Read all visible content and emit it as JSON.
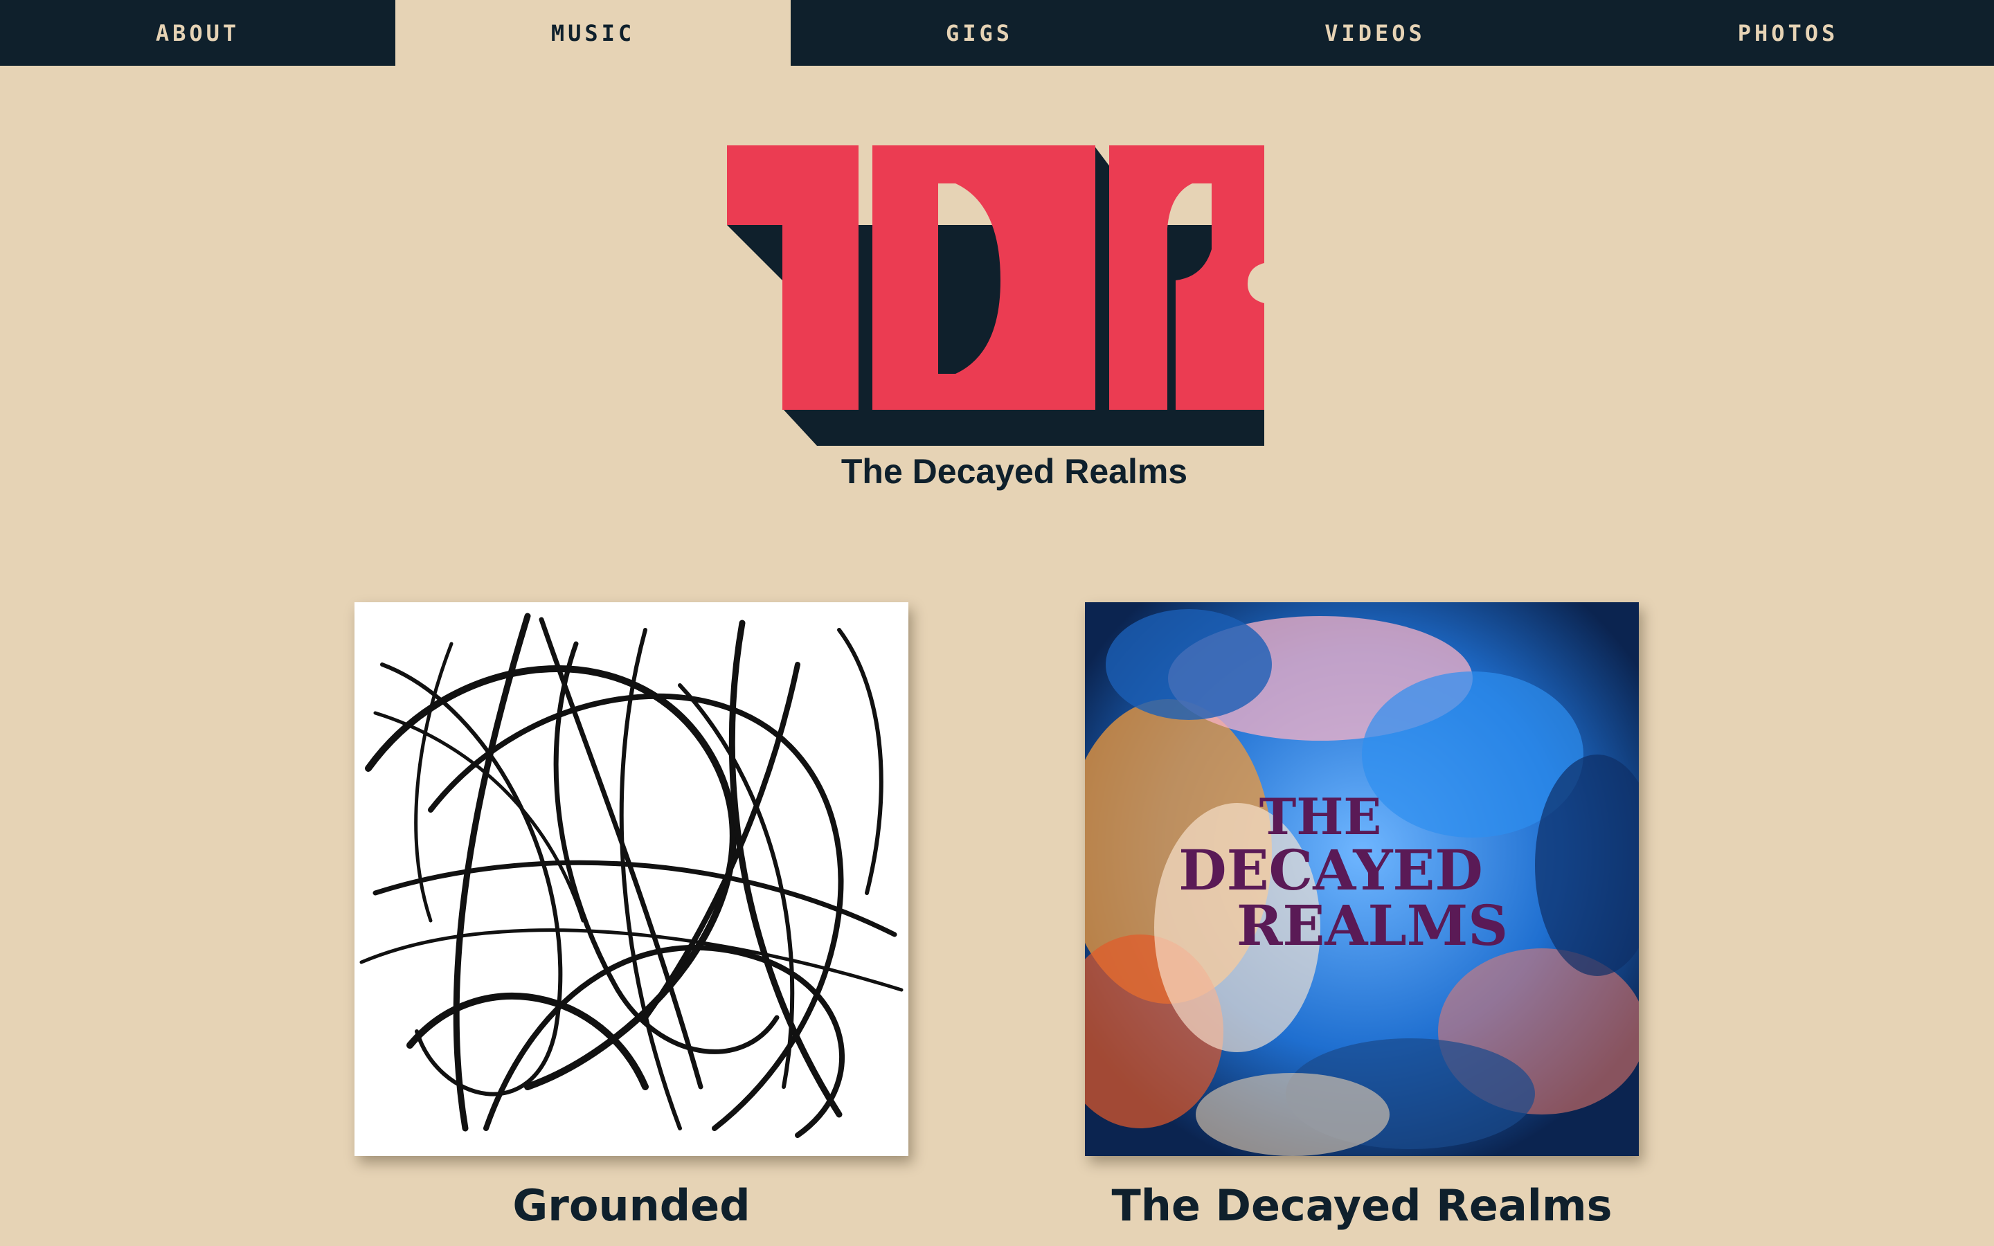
{
  "nav": {
    "items": [
      {
        "label": "ABOUT",
        "active": false
      },
      {
        "label": "MUSIC",
        "active": true
      },
      {
        "label": "GIGS",
        "active": false
      },
      {
        "label": "VIDEOS",
        "active": false
      },
      {
        "label": "PHOTOS",
        "active": false
      }
    ]
  },
  "header": {
    "logo_text": "TDR",
    "band_name": "The Decayed Realms"
  },
  "albums": [
    {
      "title": "Grounded",
      "cover": "black-scribble-art"
    },
    {
      "title": "The Decayed Realms",
      "cover": "colorful-nebula-art",
      "cover_text": [
        "THE",
        "DECAYED",
        "REALMS"
      ]
    }
  ],
  "colors": {
    "background": "#e6d3b5",
    "navy": "#0f202c",
    "logo_red": "#eb3c52",
    "cover_text_purple": "#5a1a56"
  }
}
